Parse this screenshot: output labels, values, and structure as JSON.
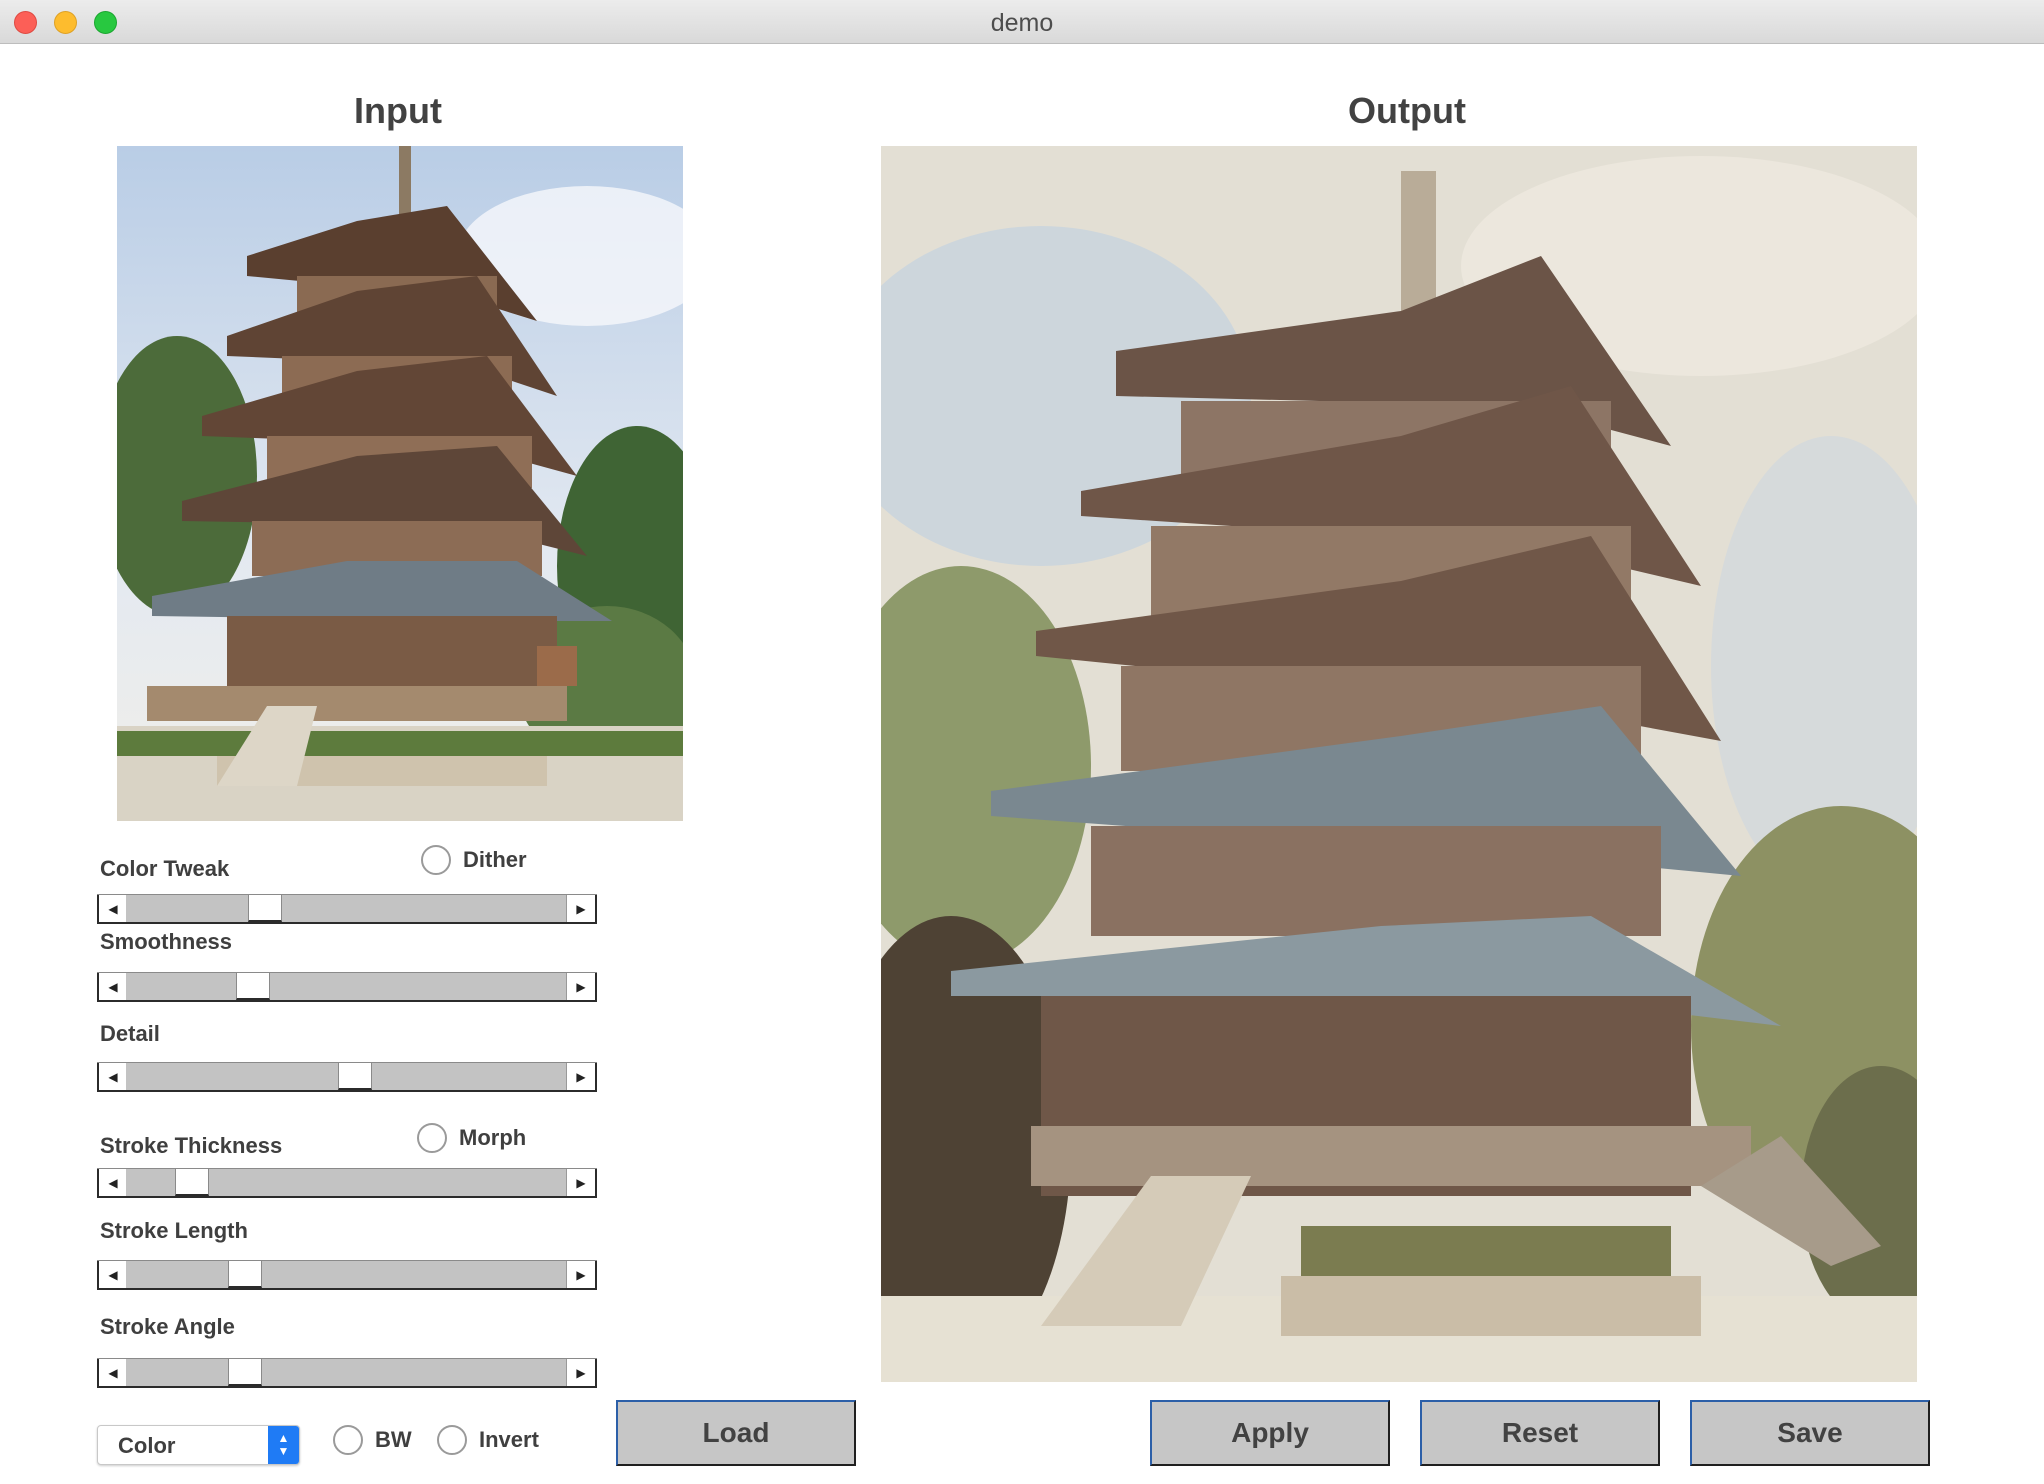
{
  "window": {
    "title": "demo"
  },
  "panels": {
    "input_title": "Input",
    "output_title": "Output"
  },
  "controls": {
    "color_tweak": {
      "label": "Color Tweak",
      "value": 0.3
    },
    "dither": {
      "label": "Dither",
      "checked": false
    },
    "smoothness": {
      "label": "Smoothness",
      "value": 0.27
    },
    "detail": {
      "label": "Detail",
      "value": 0.52
    },
    "stroke_thickness": {
      "label": "Stroke Thickness",
      "value": 0.12
    },
    "morph": {
      "label": "Morph",
      "checked": false
    },
    "stroke_length": {
      "label": "Stroke Length",
      "value": 0.25
    },
    "stroke_angle": {
      "label": "Stroke Angle",
      "value": 0.25
    },
    "mode_select": {
      "value": "Color"
    },
    "bw": {
      "label": "BW",
      "checked": false
    },
    "invert": {
      "label": "Invert",
      "checked": false
    }
  },
  "buttons": {
    "load": "Load",
    "apply": "Apply",
    "reset": "Reset",
    "save": "Save"
  },
  "colors": {
    "select_accent": "#1f7bf5",
    "button_face": "#c6c6c6",
    "button_border": "#2c5fa8"
  }
}
